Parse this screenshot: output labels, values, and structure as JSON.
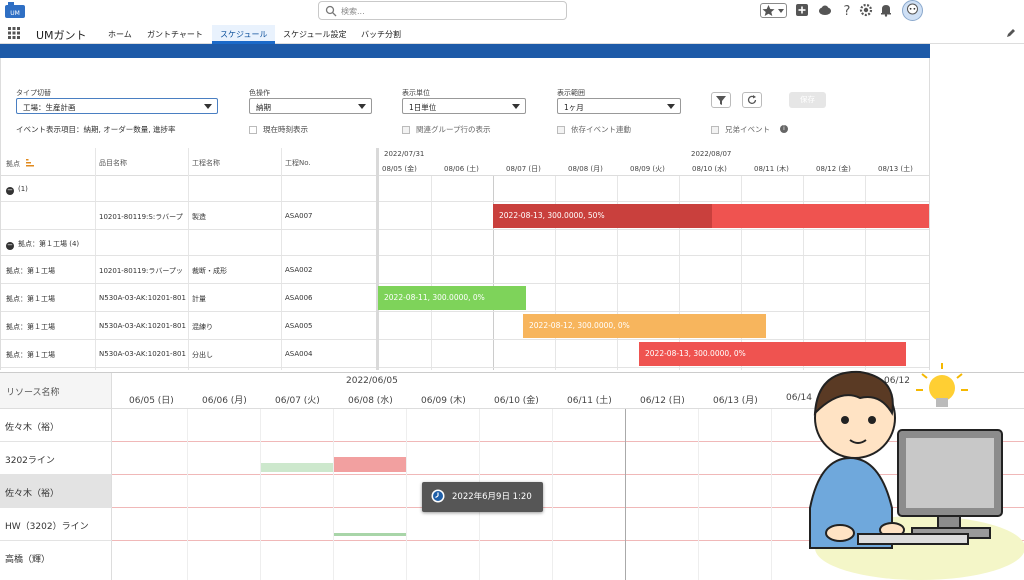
{
  "search": {
    "placeholder": "検索..."
  },
  "nav": {
    "app_name": "UMガント",
    "items": [
      "ホーム",
      "ガントチャート",
      "スケジュール",
      "スケジュール設定",
      "バッチ分割"
    ],
    "active_index": 2
  },
  "filters": {
    "type_label": "タイプ切替",
    "type_value": "工場：生産計画",
    "event_items": "イベント表示項目：納期, オーダー数量, 進捗率",
    "color_label": "色操作",
    "color_value": "納期",
    "unit_label": "表示単位",
    "unit_value": "1日単位",
    "range_label": "表示範囲",
    "range_value": "1ヶ月",
    "current_time": "現在時刻表示",
    "related_group": "関連グループ行の表示",
    "dependency": "依存イベント連動",
    "sibling": "兄弟イベント",
    "save": "保存"
  },
  "upper": {
    "headers": {
      "site": "拠点",
      "item": "品目名称",
      "process": "工程名称",
      "process_no": "工程No."
    },
    "week_labels": [
      "2022/07/31",
      "2022/08/07"
    ],
    "days": [
      "08/05 (金)",
      "08/06 (土)",
      "08/07 (日)",
      "08/08 (月)",
      "08/09 (火)",
      "08/10 (水)",
      "08/11 (木)",
      "08/12 (金)",
      "08/13 (土)"
    ],
    "group1": "(1)",
    "group2": "拠点：第１工場 (4)",
    "rows": [
      {
        "site": "",
        "item": "10201-80119:S:ラバープ",
        "process": "製造",
        "no": "ASA007"
      },
      {
        "site": "拠点：第１工場",
        "item": "10201-80119:ラバープッ",
        "process": "裁断・成形",
        "no": "ASA002"
      },
      {
        "site": "拠点：第１工場",
        "item": "N530A-03-AK:10201-801",
        "process": "計量",
        "no": "ASA006"
      },
      {
        "site": "拠点：第１工場",
        "item": "N530A-03-AK:10201-801",
        "process": "混練り",
        "no": "ASA005"
      },
      {
        "site": "拠点：第１工場",
        "item": "N530A-03-AK:10201-801",
        "process": "分出し",
        "no": "ASA004"
      }
    ],
    "bars": [
      {
        "label": "2022-08-13, 300.0000, 50%",
        "progress": 0.5,
        "color": "#ef5350",
        "done_color": "#c9403d"
      },
      {
        "label": "2022-08-11, 300.0000, 0%",
        "color": "#7ed35a"
      },
      {
        "label": "2022-08-12, 300.0000, 0%",
        "color": "#f7b55d"
      },
      {
        "label": "2022-08-13, 300.0000, 0%",
        "color": "#ef5350"
      }
    ]
  },
  "lower": {
    "resource_header": "リソース名称",
    "month_labels": [
      "2022/06/05",
      "06/12"
    ],
    "days": [
      "06/05 (日)",
      "06/06 (月)",
      "06/07 (火)",
      "06/08 (水)",
      "06/09 (木)",
      "06/10 (金)",
      "06/11 (土)",
      "06/12 (日)",
      "06/13 (月)",
      "06/14"
    ],
    "resources": [
      "佐々木（裕）",
      "3202ライン",
      "佐々木（裕）",
      "HW（3202）ライン",
      "高橋（輝）"
    ],
    "tooltip": "2022年6月9日 1:20"
  }
}
